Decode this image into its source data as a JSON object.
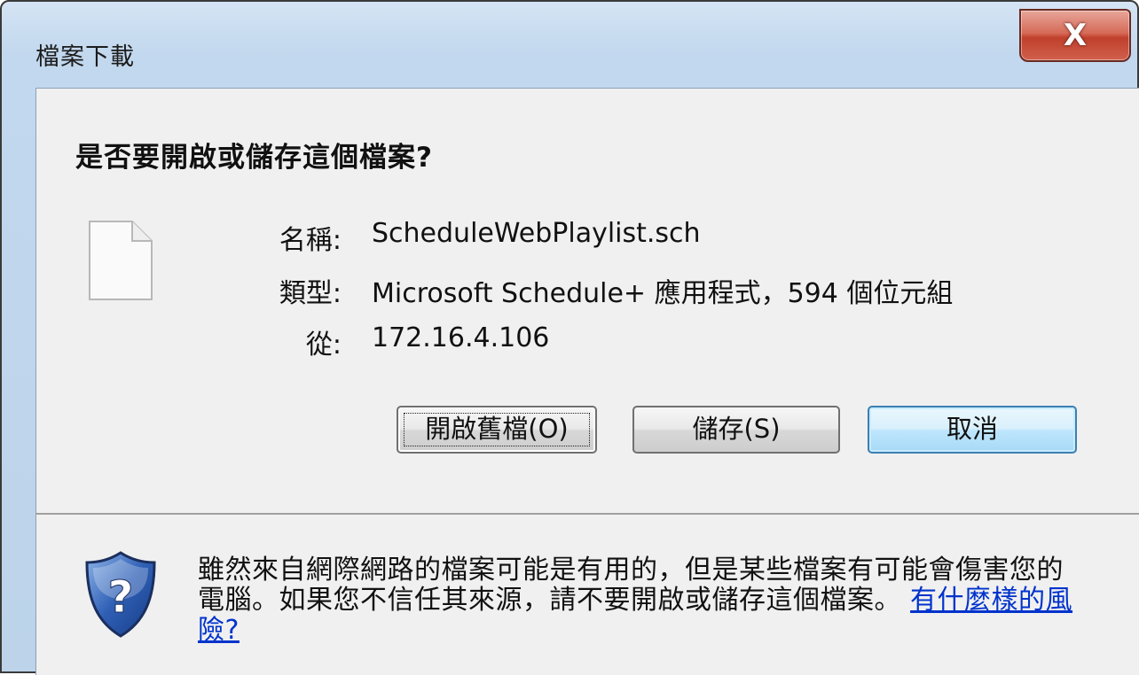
{
  "window": {
    "title": "檔案下載",
    "close_symbol": "X"
  },
  "dialog": {
    "question": "是否要開啟或儲存這個檔案?",
    "file_icon": "file-icon",
    "fields": {
      "name_label": "名稱:",
      "name_value": "ScheduleWebPlaylist.sch",
      "type_label": "類型:",
      "type_value": "Microsoft Schedule+ 應用程式，594 個位元組",
      "from_label": "從:",
      "from_value": "172.16.4.106"
    },
    "buttons": {
      "open_label": "開啟舊檔(O)",
      "save_label": "儲存(S)",
      "cancel_label": "取消"
    }
  },
  "warning": {
    "icon": "shield-question-icon",
    "text": "雖然來自網際網路的檔案可能是有用的，但是某些檔案有可能會傷害您的電腦。如果您不信任其來源，請不要開啟或儲存這個檔案。",
    "link_text": "有什麼樣的風險?"
  },
  "colors": {
    "close_button": "#c84a36",
    "link": "#0033cc",
    "default_button_border": "#3c7fb1"
  }
}
